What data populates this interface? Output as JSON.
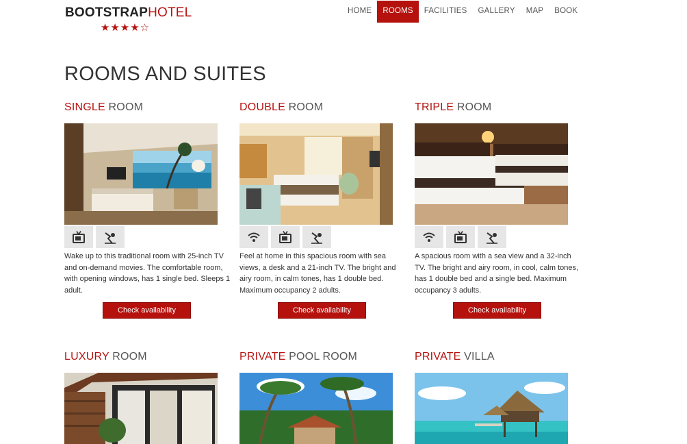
{
  "brand": {
    "bold": "BOOTSTRAP",
    "light": "HOTEL",
    "stars": "★★★★☆"
  },
  "nav": [
    {
      "label": "HOME",
      "active": false
    },
    {
      "label": "ROOMS",
      "active": true
    },
    {
      "label": "FACILITIES",
      "active": false
    },
    {
      "label": "GALLERY",
      "active": false
    },
    {
      "label": "MAP",
      "active": false
    },
    {
      "label": "BOOK",
      "active": false
    }
  ],
  "page_title": "ROOMS AND SUITES",
  "rooms": [
    {
      "accent": "SINGLE",
      "rest": "ROOM",
      "amenities": [
        "tv-icon",
        "room-service-icon"
      ],
      "description": "Wake up to this traditional room with 25-inch TV and on-demand movies. The comfortable room, with opening windows, has 1 single bed. Sleeps 1 adult.",
      "button": "Check availability"
    },
    {
      "accent": "DOUBLE",
      "rest": "ROOM",
      "amenities": [
        "wifi-icon",
        "tv-icon",
        "room-service-icon"
      ],
      "description": "Feel at home in this spacious room with sea views, a desk and a 21-inch TV. The bright and airy room, in calm tones, has 1 double bed. Maximum occupancy 2 adults.",
      "button": "Check availability"
    },
    {
      "accent": "TRIPLE",
      "rest": "ROOM",
      "amenities": [
        "wifi-icon",
        "tv-icon",
        "room-service-icon"
      ],
      "description": "A spacious room with a sea view and a 32-inch TV. The bright and airy room, in cool, calm tones, has 1 double bed and a single bed. Maximum occupancy 3 adults.",
      "button": "Check availability"
    },
    {
      "accent": "LUXURY",
      "rest": "ROOM"
    },
    {
      "accent": "PRIVATE",
      "rest": "POOL ROOM"
    },
    {
      "accent": "PRIVATE",
      "rest": "VILLA"
    }
  ],
  "colors": {
    "accent": "#b5120e",
    "icon_bg": "#e6e6e6"
  }
}
